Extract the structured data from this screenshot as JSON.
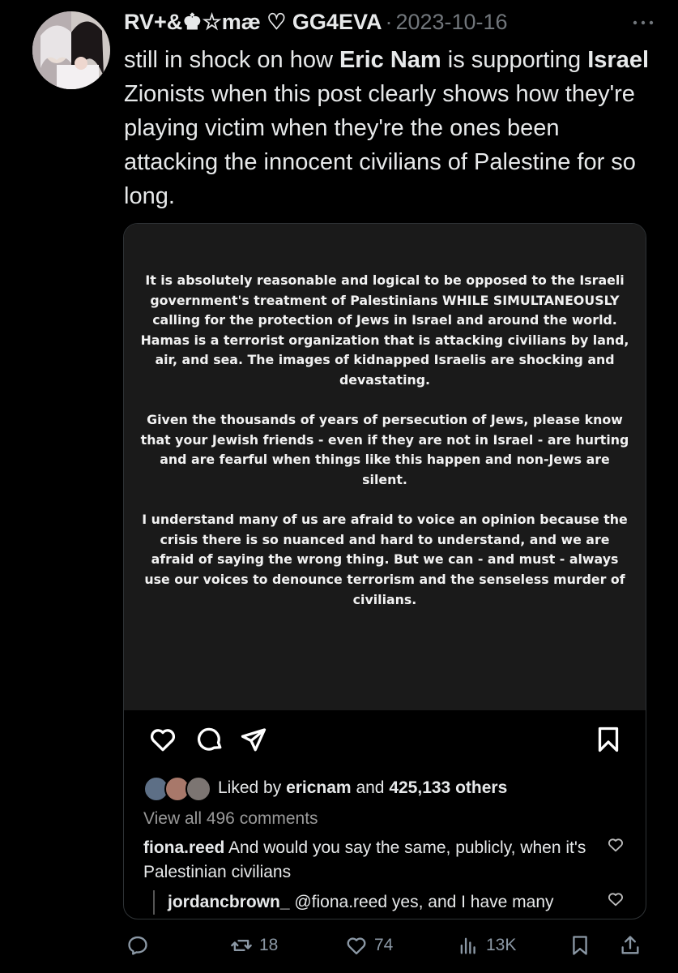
{
  "tweet": {
    "display_name": "RV+&♚☆mæ ♡ GG4EVA",
    "separator": "·",
    "date": "2023-10-16",
    "text_parts": [
      "still in shock on how ",
      "Eric Nam",
      " is supporting ",
      "Israel",
      " Zionists when this post clearly shows how they're playing victim when they're the ones been attacking the innocent civilians of Palestine for so long."
    ]
  },
  "story": {
    "paragraphs": [
      "It is absolutely reasonable and logical to be opposed to the Israeli government's treatment of Palestinians WHILE SIMULTANEOUSLY calling for the protection of Jews in Israel and around the world. Hamas is a terrorist organization that is attacking civilians by land, air, and sea. The images of kidnapped Israelis are shocking and devastating.",
      "Given the thousands of years of persecution of Jews, please know that your Jewish friends - even if they are not in Israel - are hurting and are fearful when things like this happen and non-Jews are silent.",
      "I understand many of us are afraid to voice an opinion because the crisis there is so nuanced and hard to understand, and we are afraid of saying the wrong thing. But we can - and must - always use our voices to denounce terrorism and the senseless murder of civilians."
    ]
  },
  "instagram": {
    "liked_prefix": "Liked by ",
    "liked_user": "ericnam",
    "liked_mid": " and ",
    "liked_count": "425,133 others",
    "view_all": "View all 496 comments",
    "comment_user": "fiona.reed",
    "comment_text": " And would you say the same, publicly, when it's Palestinian civilians",
    "reply_user": "jordancbrown_",
    "reply_text": " @fiona.reed yes, and I have many"
  },
  "actions": {
    "retweets": "18",
    "likes": "74",
    "views": "13K"
  },
  "colors": {
    "background": "#000000",
    "text": "#e7e9ea",
    "muted": "#71767b",
    "story_bg": "#1a1a1a"
  },
  "icons": [
    "more-icon",
    "ig-heart-icon",
    "ig-comment-icon",
    "ig-share-icon",
    "ig-bookmark-icon",
    "reply-icon",
    "retweet-icon",
    "like-icon",
    "views-icon",
    "bookmark-icon",
    "share-icon"
  ]
}
